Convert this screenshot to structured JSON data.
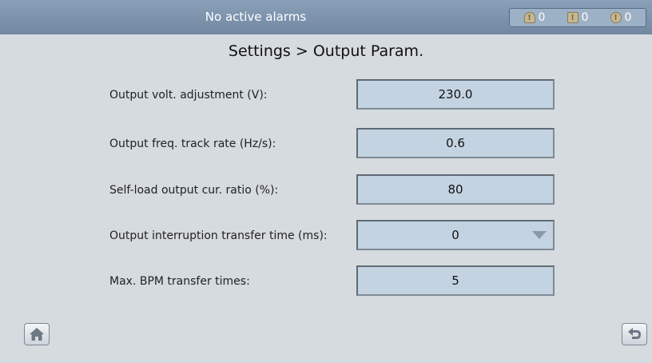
{
  "header": {
    "alarm_status": "No active alarms",
    "alarm_counts": [
      {
        "icon": "critical-alarm-icon",
        "count": "0"
      },
      {
        "icon": "major-alarm-icon",
        "count": "0"
      },
      {
        "icon": "minor-alarm-icon",
        "count": "0"
      }
    ]
  },
  "page": {
    "title": "Settings > Output Param."
  },
  "params": [
    {
      "label": "Output volt. adjustment (V):",
      "value": "230.0"
    },
    {
      "label": "Output freq. track rate (Hz/s):",
      "value": "0.6"
    },
    {
      "label": "Self-load output cur. ratio (%):",
      "value": "80"
    },
    {
      "label": "Output interruption transfer time (ms):",
      "value": "0"
    },
    {
      "label": "Max. BPM transfer times:",
      "value": "5"
    }
  ],
  "nav": {
    "home_icon": "home-icon",
    "back_icon": "back-arrow-icon"
  },
  "colors": {
    "header_bg": "#7e94ad",
    "field_bg": "#c4d3e2",
    "page_bg": "#d6dbdf"
  }
}
